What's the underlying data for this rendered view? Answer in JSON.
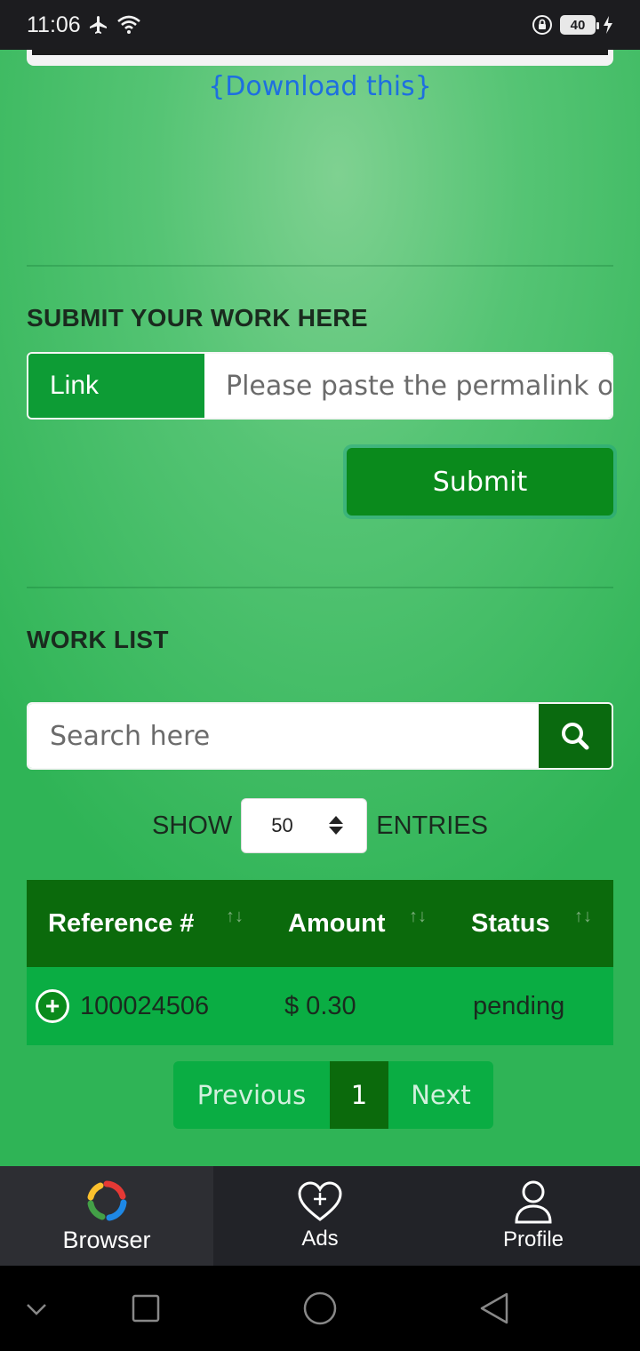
{
  "status_bar": {
    "time": "11:06",
    "battery": "40"
  },
  "content": {
    "download_link": "{Download this}",
    "submit_section": {
      "title": "SUBMIT YOUR WORK HERE",
      "link_label": "Link",
      "link_placeholder": "Please paste the permalink o",
      "submit_label": "Submit"
    },
    "work_list": {
      "title": "WORK LIST",
      "search_placeholder": "Search here",
      "show_label": "SHOW",
      "entries_value": "50",
      "entries_label": "ENTRIES",
      "columns": [
        "Reference #",
        "Amount",
        "Status"
      ],
      "rows": [
        {
          "reference": "100024506",
          "amount": "$ 0.30",
          "status": "pending"
        }
      ],
      "pagination": {
        "previous": "Previous",
        "current": "1",
        "next": "Next"
      }
    }
  },
  "bottom_nav": {
    "items": [
      {
        "label": "Browser",
        "icon": "browser-icon"
      },
      {
        "label": "Ads",
        "icon": "heart-plus-icon"
      },
      {
        "label": "Profile",
        "icon": "user-icon"
      }
    ]
  },
  "colors": {
    "accent": "#0a8a1c",
    "dark_green": "#0b6a0c",
    "link_blue": "#1e6fe0"
  }
}
